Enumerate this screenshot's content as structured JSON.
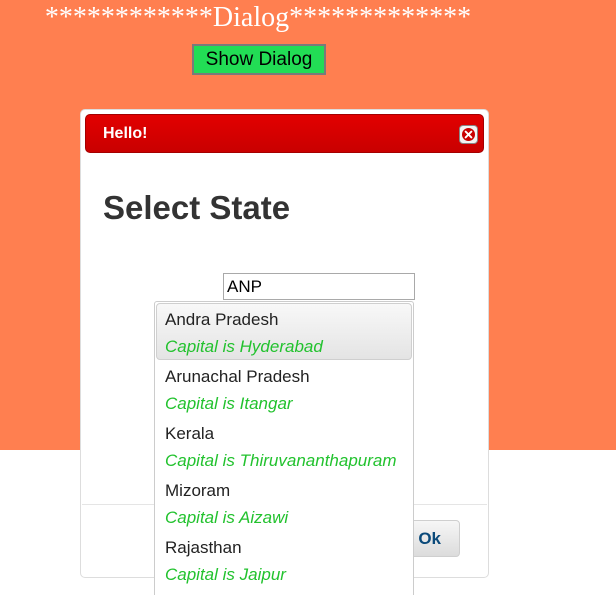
{
  "page": {
    "heading": "************Dialog*************",
    "show_button_label": "Show Dialog"
  },
  "dialog": {
    "title": "Hello!",
    "close_icon": "close-icon",
    "heading": "Select State",
    "search_value": "ANP",
    "ok_label": "Ok"
  },
  "autocomplete": {
    "items": [
      {
        "name": "Andra Pradesh",
        "capital": "Capital is Hyderabad",
        "active": true
      },
      {
        "name": "Arunachal Pradesh",
        "capital": "Capital is Itangar",
        "active": false
      },
      {
        "name": "Kerala",
        "capital": "Capital is Thiruvananthapuram",
        "active": false
      },
      {
        "name": "Mizoram",
        "capital": "Capital is Aizawi",
        "active": false
      },
      {
        "name": "Rajasthan",
        "capital": "Capital is Jaipur",
        "active": false
      }
    ]
  },
  "colors": {
    "page_background": "#ff7f50",
    "show_button": "#22dd55",
    "titlebar": "#d40000",
    "capital_text": "#22c22e",
    "ok_text": "#0b4a7a"
  }
}
